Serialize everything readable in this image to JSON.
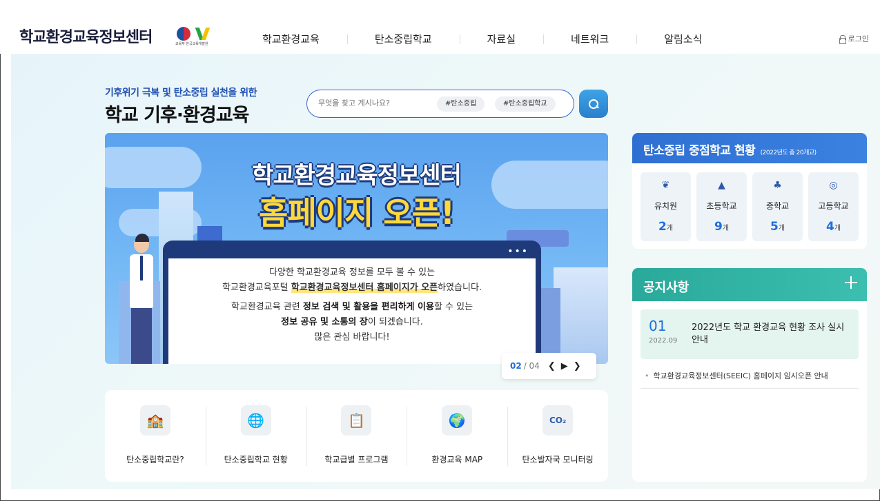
{
  "header": {
    "logo_text": "학교환경교육정보센터",
    "emblem_caption": "교육부 한국교육개발원",
    "nav": [
      "학교환경교육",
      "탄소중립학교",
      "자료실",
      "네트워크",
      "알림소식"
    ],
    "login_label": "로그인"
  },
  "hero": {
    "subtitle": "기후위기 극복 및 탄소중립 실천을 위한",
    "title": "학교 기후·환경교육"
  },
  "search": {
    "placeholder": "무엇을 찾고 계시나요?",
    "tags": [
      "#탄소중립",
      "#탄소중립학교"
    ]
  },
  "banner": {
    "title_line1": "학교환경교육정보센터",
    "title_line2": "홈페이지 오픈!",
    "body": {
      "line1": "다양한 학교환경교육 정보를 모두 볼 수 있는",
      "line2_a": "학교환경교육포털 ",
      "line2_b": "학교환경교육정보센터 홈페이지가 오픈",
      "line2_c": "하였습니다.",
      "line3_a": "학교환경교육 관련 ",
      "line3_b": "정보 검색 및 활용을 편리하게 이용",
      "line3_c": "할 수 있는",
      "line4_a": "정보 공유 및 소통의 장",
      "line4_b": "이 되겠습니다.",
      "line5": "많은 관심 바랍니다!"
    },
    "pager_current": "02",
    "pager_total": "/ 04"
  },
  "quick_links": [
    {
      "label": "탄소중립학교란?",
      "icon": "school-icon"
    },
    {
      "label": "탄소중립학교 현황",
      "icon": "globe-recycle-icon"
    },
    {
      "label": "학교급별 프로그램",
      "icon": "presentation-board-icon"
    },
    {
      "label": "환경교육 MAP",
      "icon": "globe-pin-icon"
    },
    {
      "label": "탄소발자국 모니터링",
      "icon": "co2-footprint-icon"
    }
  ],
  "carbon_schools": {
    "title": "탄소중립 중점학교 현황",
    "note": "(2022년도 총 20개교)",
    "unit": "개",
    "items": [
      {
        "name": "유치원",
        "count": "2",
        "icon": "sprout-icon"
      },
      {
        "name": "초등학교",
        "count": "9",
        "icon": "mountain-icon"
      },
      {
        "name": "중학교",
        "count": "5",
        "icon": "trees-icon"
      },
      {
        "name": "고등학교",
        "count": "4",
        "icon": "globe-icon"
      }
    ]
  },
  "notices": {
    "title": "공지사항",
    "featured": {
      "day": "01",
      "date": "2022.09",
      "title": "2022년도 학교 환경교육 현황 조사 실시 안내"
    },
    "items": [
      "학교환경교육정보센터(SEEIC) 홈페이지 임시오픈 안내"
    ]
  }
}
